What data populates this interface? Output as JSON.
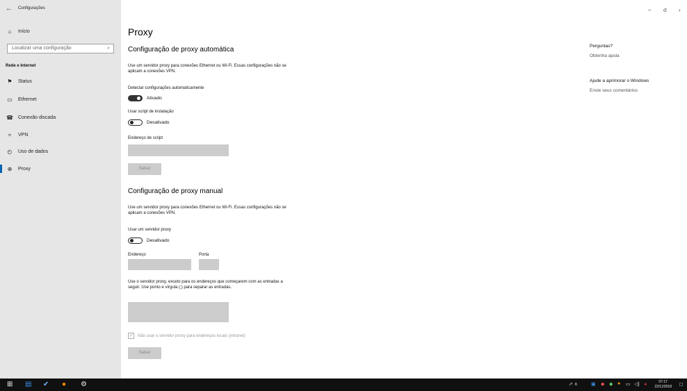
{
  "window": {
    "title": "Configurações",
    "back": "←",
    "minimize": "–",
    "maximize": "σ",
    "close": "›"
  },
  "sidebar": {
    "home": {
      "icon": "⌂",
      "label": "Início"
    },
    "search_placeholder": "Localizar uma configuração",
    "search_icon": "⌕",
    "section": "Rede e Internet",
    "items": [
      {
        "icon": "⚑",
        "label": "Status"
      },
      {
        "icon": "▭",
        "label": "Ethernet"
      },
      {
        "icon": "☎",
        "label": "Conexão discada"
      },
      {
        "icon": "≈",
        "label": "VPN"
      },
      {
        "icon": "◴",
        "label": "Uso de dados"
      },
      {
        "icon": "⊕",
        "label": "Proxy"
      }
    ]
  },
  "main": {
    "title": "Proxy",
    "auto": {
      "heading": "Configuração de proxy automática",
      "desc": "Use um servidor proxy para conexões Ethernet ou Wi-Fi. Essas configurações não se aplicam a conexões VPN.",
      "detect_label": "Detectar configurações automaticamente",
      "detect_state": "Ativado",
      "script_label": "Usar script de instalação",
      "script_state": "Desativado",
      "address_label": "Endereço de script",
      "save": "Salvar"
    },
    "manual": {
      "heading": "Configuração de proxy manual",
      "desc": "Use um servidor proxy para conexões Ethernet ou Wi-Fi. Essas configurações não se aplicam a conexões VPN.",
      "use_label": "Usar um servidor proxy",
      "use_state": "Desativado",
      "address_label": "Endereço",
      "port_label": "Porta",
      "exceptions_desc": "Use o servidor proxy, exceto para os endereços que começarem com as entradas a seguir. Use ponto e vírgula (;) para separar as entradas.",
      "local_checkbox": "Não usar o servidor proxy para endereços locais (intranet)",
      "save": "Salvar"
    }
  },
  "right_panel": {
    "q_heading": "Perguntas?",
    "q_link": "Obtenha ajuda",
    "improve_heading": "Ajude a aprimorar o Windows",
    "improve_link": "Envie seus comentários"
  },
  "taskbar": {
    "time": "07:17",
    "date": "22/11/2018",
    "tray": "⬀  ∧",
    "notifications_icon": "□"
  }
}
